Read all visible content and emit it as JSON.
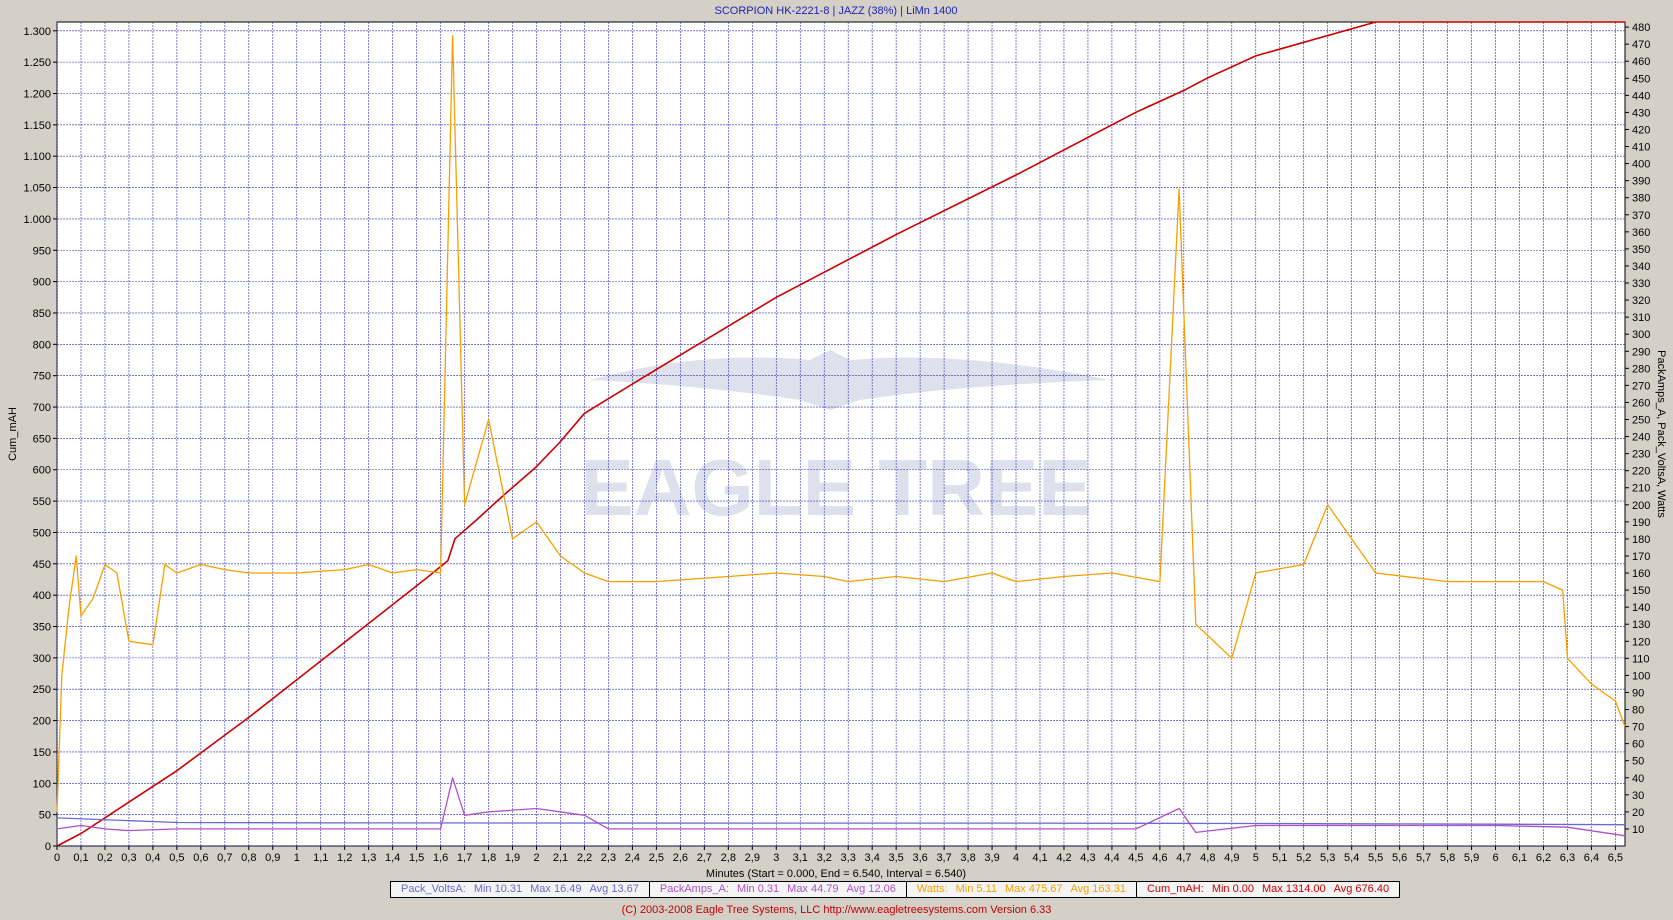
{
  "chart_data": {
    "type": "line",
    "title": "SCORPION HK-2221-8 | JAZZ (38%) | LiMn 1400",
    "xlabel": "Minutes (Start = 0.000,  End = 6.540,  Interval =  6.540)",
    "ylabel_left": "Cum_mAH",
    "ylabel_right": "PackAmps_A, Pack_VoltsA, Watts",
    "xlim": [
      0,
      6.54
    ],
    "ylim_left": [
      0,
      1314
    ],
    "ylim_right": [
      0,
      483
    ],
    "x_ticks": [
      "0",
      "0,1",
      "0,2",
      "0,3",
      "0,4",
      "0,5",
      "0,6",
      "0,7",
      "0,8",
      "0,9",
      "1",
      "1,1",
      "1,2",
      "1,3",
      "1,4",
      "1,5",
      "1,6",
      "1,7",
      "1,8",
      "1,9",
      "2",
      "2,1",
      "2,2",
      "2,3",
      "2,4",
      "2,5",
      "2,6",
      "2,7",
      "2,8",
      "2,9",
      "3",
      "3,1",
      "3,2",
      "3,3",
      "3,4",
      "3,5",
      "3,6",
      "3,7",
      "3,8",
      "3,9",
      "4",
      "4,1",
      "4,2",
      "4,3",
      "4,4",
      "4,5",
      "4,6",
      "4,7",
      "4,8",
      "4,9",
      "5",
      "5,1",
      "5,2",
      "5,3",
      "5,4",
      "5,5",
      "5,6",
      "5,7",
      "5,8",
      "5,9",
      "6",
      "6,1",
      "6,2",
      "6,3",
      "6,4",
      "6,5"
    ],
    "y_ticks_left": [
      "0",
      "50",
      "100",
      "150",
      "200",
      "250",
      "300",
      "350",
      "400",
      "450",
      "500",
      "550",
      "600",
      "650",
      "700",
      "750",
      "800",
      "850",
      "900",
      "950",
      "1.000",
      "1.050",
      "1.100",
      "1.150",
      "1.200",
      "1.250",
      "1.300"
    ],
    "y_ticks_right": [
      "10",
      "20",
      "30",
      "40",
      "50",
      "60",
      "70",
      "80",
      "90",
      "100",
      "110",
      "120",
      "130",
      "140",
      "150",
      "160",
      "170",
      "180",
      "190",
      "200",
      "210",
      "220",
      "230",
      "240",
      "250",
      "260",
      "270",
      "280",
      "290",
      "300",
      "310",
      "320",
      "330",
      "340",
      "350",
      "360",
      "370",
      "380",
      "390",
      "400",
      "410",
      "420",
      "430",
      "440",
      "450",
      "460",
      "470",
      "480"
    ],
    "grid": true,
    "series": [
      {
        "name": "Cum_mAH",
        "axis": "left",
        "color": "#cc0000",
        "x": [
          0,
          0.1,
          0.2,
          0.3,
          0.4,
          0.5,
          0.8,
          1.0,
          1.3,
          1.55,
          1.63,
          1.66,
          1.75,
          1.85,
          2.0,
          2.1,
          2.2,
          2.5,
          3.0,
          3.5,
          4.0,
          4.5,
          4.7,
          4.8,
          5.0,
          5.5,
          6.0,
          6.3,
          6.54
        ],
        "y": [
          0,
          20,
          45,
          70,
          95,
          120,
          205,
          265,
          355,
          430,
          455,
          490,
          520,
          555,
          605,
          645,
          690,
          760,
          875,
          975,
          1070,
          1170,
          1205,
          1225,
          1260,
          1345,
          1430,
          1480,
          1314
        ]
      },
      {
        "name": "Watts",
        "axis": "right",
        "color": "#f5a000",
        "x": [
          0,
          0.02,
          0.05,
          0.08,
          0.1,
          0.15,
          0.2,
          0.25,
          0.3,
          0.4,
          0.45,
          0.5,
          0.6,
          0.7,
          0.8,
          1.0,
          1.2,
          1.3,
          1.4,
          1.5,
          1.6,
          1.65,
          1.7,
          1.8,
          1.9,
          2.0,
          2.1,
          2.2,
          2.3,
          2.5,
          2.8,
          3.0,
          3.2,
          3.3,
          3.5,
          3.7,
          3.9,
          4.0,
          4.2,
          4.4,
          4.6,
          4.68,
          4.75,
          4.9,
          5.0,
          5.2,
          5.3,
          5.5,
          5.8,
          6.0,
          6.2,
          6.28,
          6.3,
          6.4,
          6.5,
          6.54
        ],
        "y": [
          20,
          100,
          140,
          170,
          135,
          145,
          165,
          160,
          120,
          118,
          165,
          160,
          165,
          162,
          160,
          160,
          162,
          165,
          160,
          162,
          160,
          475,
          200,
          250,
          180,
          190,
          170,
          160,
          155,
          155,
          158,
          160,
          158,
          155,
          158,
          155,
          160,
          155,
          158,
          160,
          155,
          385,
          130,
          110,
          160,
          165,
          200,
          160,
          155,
          155,
          155,
          150,
          110,
          95,
          85,
          70
        ]
      },
      {
        "name": "PackAmps_A",
        "axis": "right",
        "color": "#b050c8",
        "x": [
          0,
          0.1,
          0.2,
          0.3,
          0.5,
          1.0,
          1.5,
          1.6,
          1.65,
          1.7,
          1.8,
          2.0,
          2.2,
          2.3,
          3.0,
          3.5,
          4.0,
          4.5,
          4.68,
          4.75,
          5.0,
          5.5,
          6.0,
          6.3,
          6.54
        ],
        "y": [
          10,
          12,
          10,
          9,
          10,
          10,
          10,
          10,
          40,
          18,
          20,
          22,
          18,
          10,
          10,
          10,
          10,
          10,
          22,
          8,
          12,
          12,
          12,
          11,
          6
        ]
      },
      {
        "name": "Pack_VoltsA",
        "axis": "right",
        "color": "#6a6ad0",
        "x": [
          0,
          0.5,
          1.0,
          2.0,
          3.0,
          4.0,
          5.0,
          6.0,
          6.54
        ],
        "y": [
          16.5,
          13.8,
          13.6,
          13.5,
          13.4,
          13.4,
          13.2,
          12.8,
          12.5
        ]
      }
    ],
    "legend": [
      {
        "name": "Pack_VoltsA",
        "min": "Min 10.31",
        "max": "Max 16.49",
        "avg": "Avg 13.67",
        "color": "#6a6ad0"
      },
      {
        "name": "PackAmps_A",
        "min": "Min 0.31",
        "max": "Max 44.79",
        "avg": "Avg 12.06",
        "color": "#b050c8"
      },
      {
        "name": "Watts",
        "min": "Min 5.11",
        "max": "Max 475.67",
        "avg": "Avg 163.31",
        "color": "#f5a000"
      },
      {
        "name": "Cum_mAH",
        "min": "Min 0.00",
        "max": "Max 1314.00",
        "avg": "Avg 676.40",
        "color": "#cc0000"
      }
    ]
  },
  "watermark": "EAGLE TREE",
  "copyright": "(C) 2003-2008 Eagle Tree Systems, LLC      http://www.eagletreesystems.com    Version 6.33"
}
